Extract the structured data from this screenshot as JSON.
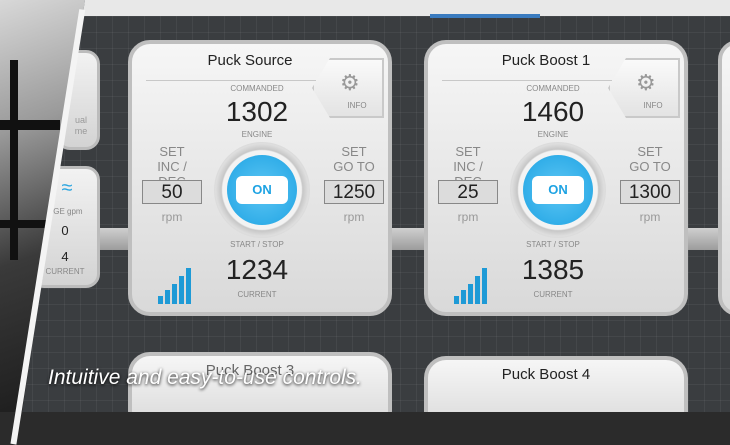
{
  "cards": [
    {
      "title": "Puck Source",
      "commanded_label": "COMMANDED",
      "commanded_value": "1302",
      "engine_label": "ENGINE",
      "left_set": "SET",
      "left_mode": "INC / DEC",
      "left_value": "50",
      "left_unit": "rpm",
      "right_set": "SET",
      "right_mode": "GO TO",
      "right_value": "1250",
      "right_unit": "rpm",
      "on_label": "ON",
      "startstop_label": "START / STOP",
      "current_value": "1234",
      "current_label": "CURRENT",
      "info_label": "INFO"
    },
    {
      "title": "Puck Boost 1",
      "commanded_label": "COMMANDED",
      "commanded_value": "1460",
      "engine_label": "ENGINE",
      "left_set": "SET",
      "left_mode": "INC / DEC",
      "left_value": "25",
      "left_unit": "rpm",
      "right_set": "SET",
      "right_mode": "GO TO",
      "right_value": "1300",
      "right_unit": "rpm",
      "on_label": "ON",
      "startstop_label": "START / STOP",
      "current_value": "1385",
      "current_label": "CURRENT",
      "info_label": "INFO"
    }
  ],
  "side_panel": {
    "manual_text": "ual",
    "manual_text2": "me",
    "discharge_label": "RGE gpm",
    "value_top": "0",
    "value_bottom": "4",
    "current_label": "CURRENT"
  },
  "bottom_cards": [
    {
      "title": "Puck Boost 3"
    },
    {
      "title": "Puck Boost 4"
    }
  ],
  "caption": "Intuitive and easy-to-use controls.",
  "colors": {
    "accent": "#1ea3e3",
    "signal": "#1e9ad6"
  }
}
